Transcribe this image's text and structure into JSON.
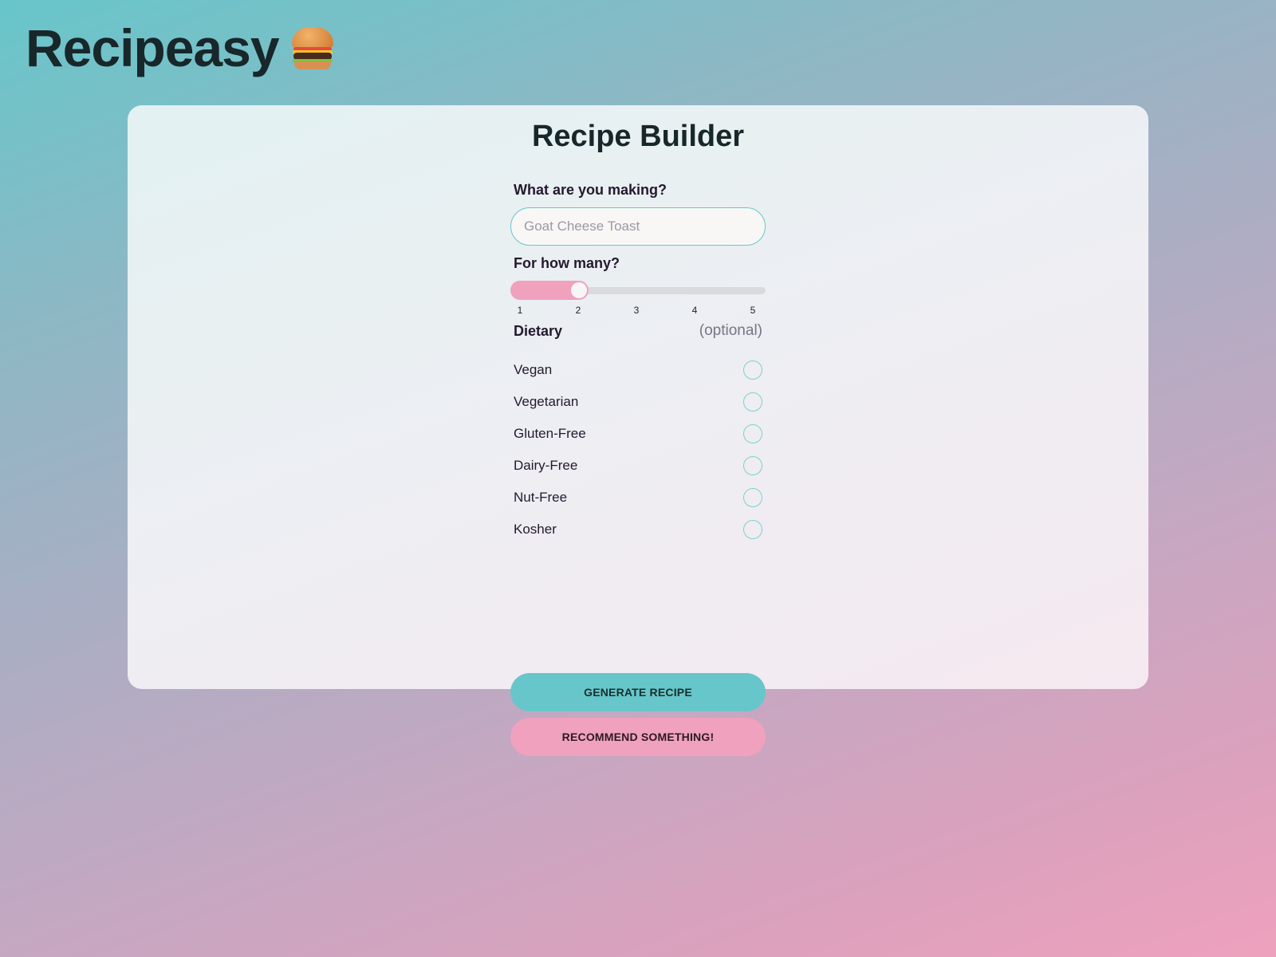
{
  "app": {
    "title": "Recipeasy",
    "logo_icon": "burger-emoji"
  },
  "card": {
    "title": "Recipe Builder"
  },
  "form": {
    "making": {
      "label": "What are you making?",
      "value": "",
      "placeholder": "Goat Cheese Toast"
    },
    "servings": {
      "label": "For how many?",
      "min": 1,
      "max": 5,
      "value": 2,
      "ticks": [
        "1",
        "2",
        "3",
        "4",
        "5"
      ]
    },
    "dietary": {
      "label": "Dietary",
      "optional_label": "(optional)",
      "options": [
        {
          "label": "Vegan",
          "checked": false
        },
        {
          "label": "Vegetarian",
          "checked": false
        },
        {
          "label": "Gluten-Free",
          "checked": false
        },
        {
          "label": "Dairy-Free",
          "checked": false
        },
        {
          "label": "Nut-Free",
          "checked": false
        },
        {
          "label": "Kosher",
          "checked": false
        }
      ]
    },
    "buttons": {
      "generate": "GENERATE RECIPE",
      "recommend": "RECOMMEND SOMETHING!"
    }
  },
  "colors": {
    "accent_teal": "#67c6ca",
    "accent_pink": "#f0a1bd",
    "text_dark": "#18272a"
  }
}
